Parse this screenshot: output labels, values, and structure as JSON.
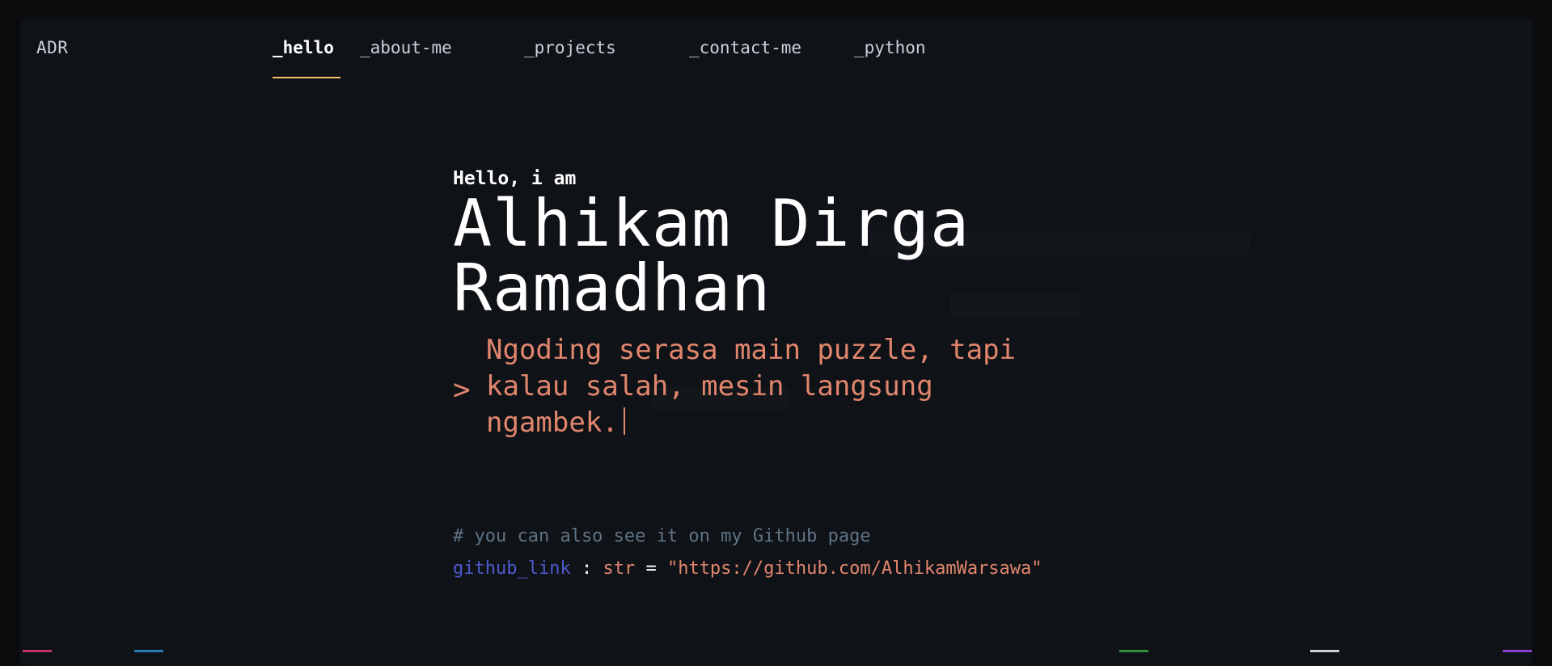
{
  "logo": "ADR",
  "nav": {
    "items": [
      {
        "label": "_hello",
        "active": true
      },
      {
        "label": "_about-me",
        "active": false
      },
      {
        "label": "_projects",
        "active": false
      },
      {
        "label": "_contact-me",
        "active": false
      },
      {
        "label": "_python",
        "active": false
      }
    ]
  },
  "hero": {
    "greeting": "Hello, i am",
    "name_line1": "Alhikam Dirga",
    "name_line2": "Ramadhan",
    "prompt_symbol": ">",
    "tagline_line1": "Ngoding serasa main puzzle, tapi",
    "tagline_line2": "kalau salah, mesin langsung",
    "tagline_line3": "ngambek."
  },
  "code": {
    "comment": "# you can also see it on my Github page",
    "var_name": "github_link",
    "colon": ":",
    "type": "str",
    "equals": "=",
    "value": "\"https://github.com/AlhikamWarsawa\""
  },
  "colors": {
    "accent_underline": "#f3c46c",
    "tagline": "#e1866d",
    "variable": "#4d5bce",
    "comment": "#5f7385"
  }
}
